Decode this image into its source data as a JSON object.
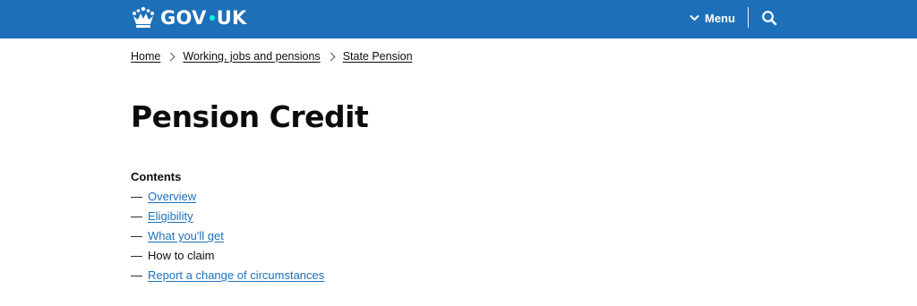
{
  "header": {
    "logo_left": "GOV",
    "logo_right": "UK",
    "menu_label": "Menu",
    "colors": {
      "background": "#1d70b8",
      "dot": "#00ffe0"
    },
    "icons": {
      "crown": "crown-icon",
      "menu": "chevron-down-icon",
      "search": "search-icon"
    }
  },
  "breadcrumbs": [
    {
      "label": "Home"
    },
    {
      "label": "Working, jobs and pensions"
    },
    {
      "label": "State Pension"
    }
  ],
  "page": {
    "title": "Pension Credit"
  },
  "contents": {
    "heading": "Contents",
    "dash": "—",
    "items": [
      {
        "label": "Overview",
        "current": false
      },
      {
        "label": "Eligibility",
        "current": false
      },
      {
        "label": "What you'll get",
        "current": false
      },
      {
        "label": "How to claim",
        "current": true
      },
      {
        "label": "Report a change of circumstances",
        "current": false
      }
    ],
    "link_color": "#1d70b8"
  }
}
